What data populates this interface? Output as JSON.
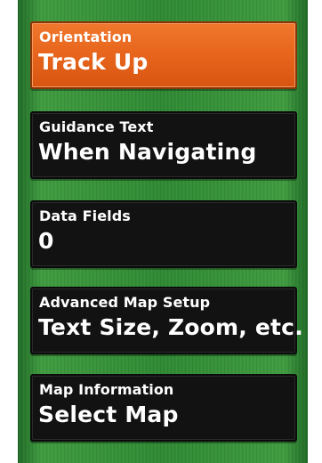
{
  "menu": {
    "items": [
      {
        "label": "Orientation",
        "value": "Track Up",
        "selected": true
      },
      {
        "label": "Guidance Text",
        "value": "When Navigating",
        "selected": false
      },
      {
        "label": "Data Fields",
        "value": "0",
        "selected": false
      },
      {
        "label": "Advanced Map Setup",
        "value": "Text Size, Zoom, etc.",
        "selected": false
      },
      {
        "label": "Map Information",
        "value": "Select Map",
        "selected": false
      }
    ]
  },
  "colors": {
    "background": "#ffffff",
    "panel_green": "#2f8a33",
    "item_bg": "#121212",
    "selected_orange": "#e8661d",
    "text": "#ffffff"
  }
}
